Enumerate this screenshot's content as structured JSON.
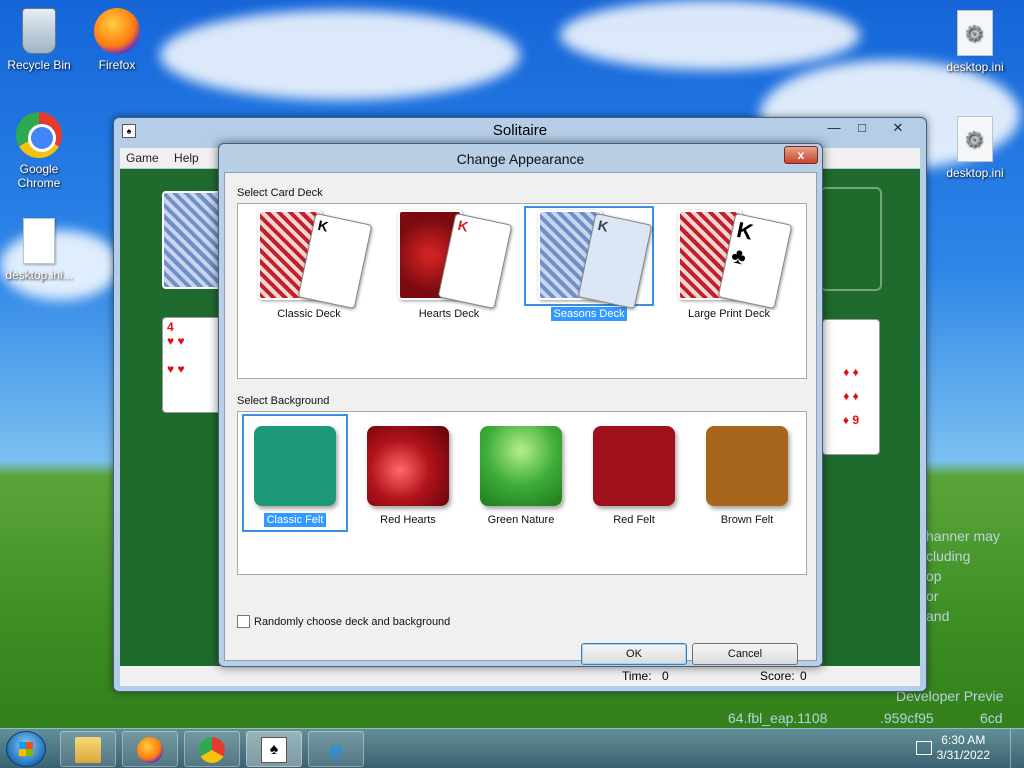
{
  "desktop": {
    "icons": [
      {
        "label": "Recycle Bin",
        "icon": "recycle-bin-icon"
      },
      {
        "label": "Firefox",
        "icon": "firefox-icon"
      },
      {
        "label": "Google Chrome",
        "icon": "chrome-icon"
      },
      {
        "label": "desktop.ini...",
        "icon": "file-icon"
      },
      {
        "label": "desktop.ini",
        "icon": "settings-file-icon"
      },
      {
        "label": "desktop.ini",
        "icon": "settings-file-icon"
      }
    ],
    "background_text": [
      "hanner may",
      "cluding",
      "op",
      "or",
      "and",
      "Developer Previe",
      "64.fbl_eap.1108",
      ".959cf95",
      "6cd"
    ]
  },
  "solitaire": {
    "title": "Solitaire",
    "menu": [
      "Game",
      "Help"
    ],
    "status": {
      "time_label": "Time:",
      "time_value": "0",
      "score_label": "Score:",
      "score_value": "0"
    },
    "cards": {
      "left_rank": "4",
      "right_rank": "9"
    }
  },
  "dialog": {
    "title": "Change Appearance",
    "close": "x",
    "deck_section": "Select Card Deck",
    "decks": [
      {
        "label": "Classic Deck",
        "rank": "K",
        "selected": false
      },
      {
        "label": "Hearts Deck",
        "rank": "K",
        "selected": false
      },
      {
        "label": "Seasons Deck",
        "rank": "K",
        "selected": true
      },
      {
        "label": "Large Print Deck",
        "rank": "K",
        "selected": false
      }
    ],
    "background_section": "Select Background",
    "backgrounds": [
      {
        "label": "Classic Felt",
        "color": "#1c9a78",
        "selected": true
      },
      {
        "label": "Red Hearts",
        "color": "#b3131b",
        "selected": false
      },
      {
        "label": "Green Nature",
        "color": "#3fae3a",
        "selected": false
      },
      {
        "label": "Red Felt",
        "color": "#9e101c",
        "selected": false
      },
      {
        "label": "Brown Felt",
        "color": "#a8651c",
        "selected": false
      }
    ],
    "random_checkbox": {
      "label": "Randomly choose deck and background",
      "checked": false
    },
    "ok": "OK",
    "cancel": "Cancel"
  },
  "taskbar": {
    "items": [
      "start-button",
      "file-explorer-icon",
      "firefox-icon",
      "chrome-icon",
      "solitaire-icon",
      "internet-explorer-icon"
    ],
    "active": "solitaire-icon",
    "time": "6:30 AM",
    "date": "3/31/2022"
  },
  "colors": {
    "selection": "#3399ff",
    "felt": "#1f6b2d",
    "dialog_frame": "#b8cfe6"
  }
}
